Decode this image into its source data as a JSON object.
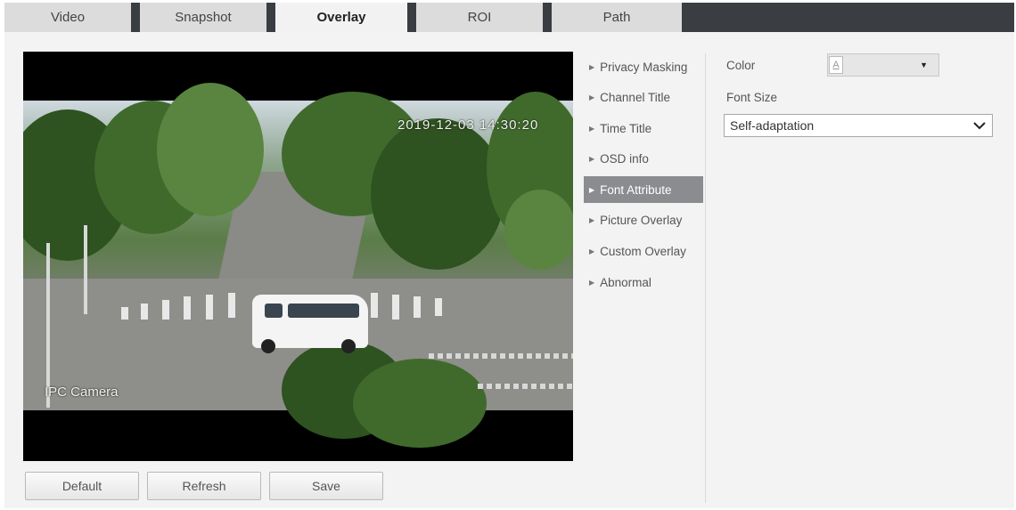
{
  "tabs": [
    {
      "label": "Video"
    },
    {
      "label": "Snapshot"
    },
    {
      "label": "Overlay",
      "active": true
    },
    {
      "label": "ROI"
    },
    {
      "label": "Path"
    }
  ],
  "video": {
    "timestamp": "2019-12-03 14:30:20",
    "channel_title": "IPC Camera"
  },
  "buttons": {
    "default": "Default",
    "refresh": "Refresh",
    "save": "Save"
  },
  "menu": {
    "items": [
      {
        "label": "Privacy Masking"
      },
      {
        "label": "Channel Title"
      },
      {
        "label": "Time Title"
      },
      {
        "label": "OSD info"
      },
      {
        "label": "Font Attribute",
        "active": true
      },
      {
        "label": "Picture Overlay"
      },
      {
        "label": "Custom Overlay"
      },
      {
        "label": "Abnormal"
      }
    ]
  },
  "settings": {
    "color_label": "Color",
    "color_value": "#ffffff",
    "color_glyph": "A",
    "font_size_label": "Font Size",
    "font_size_value": "Self-adaptation"
  },
  "colors": {
    "tabbar_bg": "#3a3d42",
    "active_menu_bg": "#8a8c90"
  }
}
